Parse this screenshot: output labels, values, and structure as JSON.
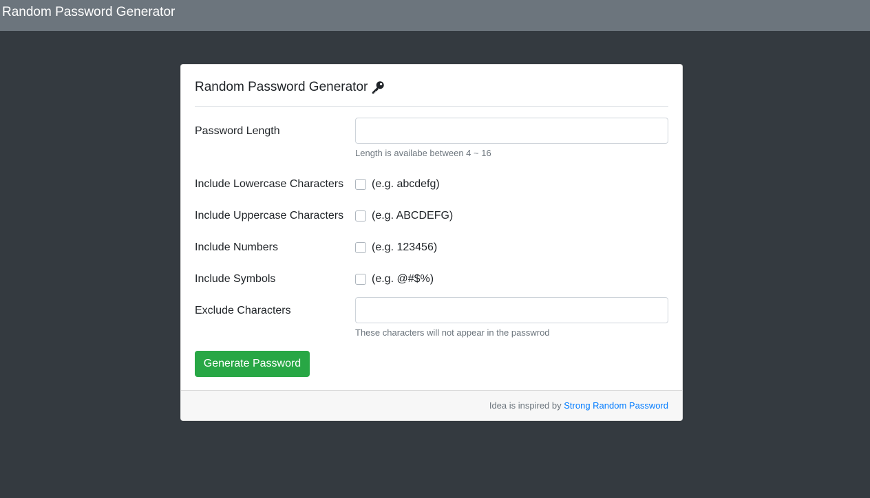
{
  "navbar": {
    "brand": "Random Password Generator"
  },
  "card": {
    "title": "Random Password Generator",
    "title_icon": "key-icon"
  },
  "form": {
    "length": {
      "label": "Password Length",
      "value": "",
      "help": "Length is availabe between 4 ~ 16"
    },
    "lowercase": {
      "label": "Include Lowercase Characters",
      "example": "(e.g. abcdefg)",
      "checked": false
    },
    "uppercase": {
      "label": "Include Uppercase Characters",
      "example": "(e.g. ABCDEFG)",
      "checked": false
    },
    "numbers": {
      "label": "Include Numbers",
      "example": "(e.g. 123456)",
      "checked": false
    },
    "symbols": {
      "label": "Include Symbols",
      "example": "(e.g. @#$%)",
      "checked": false
    },
    "exclude": {
      "label": "Exclude Characters",
      "value": "",
      "help": "These characters will not appear in the passwrod"
    },
    "submit_label": "Generate Password"
  },
  "footer": {
    "text": "Idea is inspired by",
    "link_text": "Strong Random Password"
  },
  "colors": {
    "page_bg": "#343a40",
    "navbar_bg": "#6c757d",
    "button_bg": "#28a745",
    "link": "#007bff"
  }
}
